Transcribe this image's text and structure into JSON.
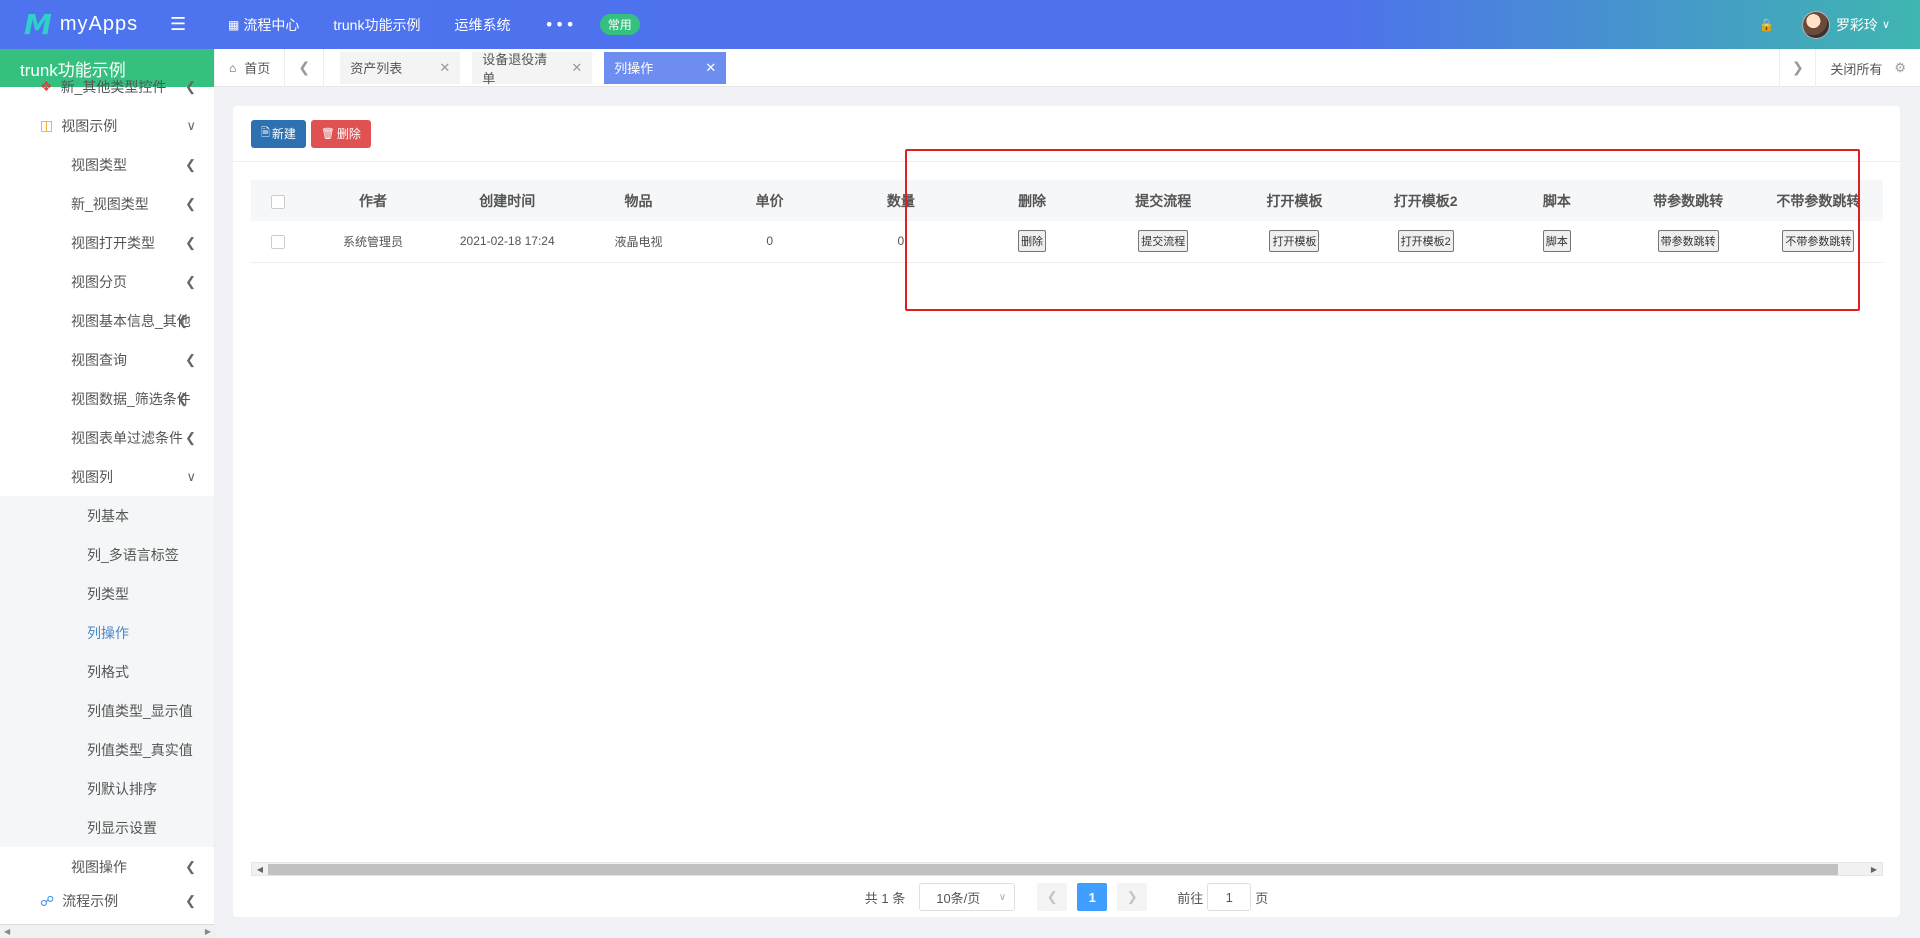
{
  "app": {
    "logo_mark": "M",
    "logo_text": "myApps"
  },
  "topnav": {
    "items": [
      {
        "label": "流程中心"
      },
      {
        "label": "trunk功能示例"
      },
      {
        "label": "运维系统"
      }
    ],
    "more": "•••",
    "badge": "常用"
  },
  "user": {
    "name": "罗彩玲"
  },
  "sidebar": {
    "header": "trunk功能示例",
    "items": [
      {
        "label": "新_其他类型控件"
      },
      {
        "label": "视图示例"
      },
      {
        "label": "视图类型"
      },
      {
        "label": "新_视图类型"
      },
      {
        "label": "视图打开类型"
      },
      {
        "label": "视图分页"
      },
      {
        "label": "视图基本信息_其他"
      },
      {
        "label": "视图查询"
      },
      {
        "label": "视图数据_筛选条件"
      },
      {
        "label": "视图表单过滤条件"
      },
      {
        "label": "视图列"
      },
      {
        "label": "列基本"
      },
      {
        "label": "列_多语言标签"
      },
      {
        "label": "列类型"
      },
      {
        "label": "列操作"
      },
      {
        "label": "列格式"
      },
      {
        "label": "列值类型_显示值"
      },
      {
        "label": "列值类型_真实值"
      },
      {
        "label": "列默认排序"
      },
      {
        "label": "列显示设置"
      },
      {
        "label": "视图操作"
      },
      {
        "label": "流程示例"
      }
    ]
  },
  "tabs": {
    "home": "首页",
    "items": [
      {
        "label": "资产列表"
      },
      {
        "label": "设备退役清单"
      },
      {
        "label": "列操作"
      }
    ],
    "close_all": "关闭所有"
  },
  "toolbar": {
    "new_label": "新建",
    "delete_label": "删除"
  },
  "table": {
    "columns": [
      "作者",
      "创建时间",
      "物品",
      "单价",
      "数量",
      "删除",
      "提交流程",
      "打开模板",
      "打开模板2",
      "脚本",
      "带参数跳转",
      "不带参数跳转"
    ],
    "rows": [
      {
        "author": "系统管理员",
        "created": "2021-02-18 17:24",
        "item": "液晶电视",
        "price": "0",
        "qty": "0",
        "btn_delete": "删除",
        "btn_submit": "提交流程",
        "btn_open": "打开模板",
        "btn_open2": "打开模板2",
        "btn_script": "脚本",
        "btn_jump_param": "带参数跳转",
        "btn_jump_noparam": "不带参数跳转"
      }
    ]
  },
  "pager": {
    "total": "共 1 条",
    "page_size": "10条/页",
    "current_page": "1",
    "goto_label": "前往",
    "goto_value": "1",
    "page_unit": "页"
  },
  "colors": {
    "topbar": "#4e73ef",
    "sidebar_header": "#35c07f",
    "active_tab": "#6d8ef0",
    "highlight": "#e02020"
  }
}
